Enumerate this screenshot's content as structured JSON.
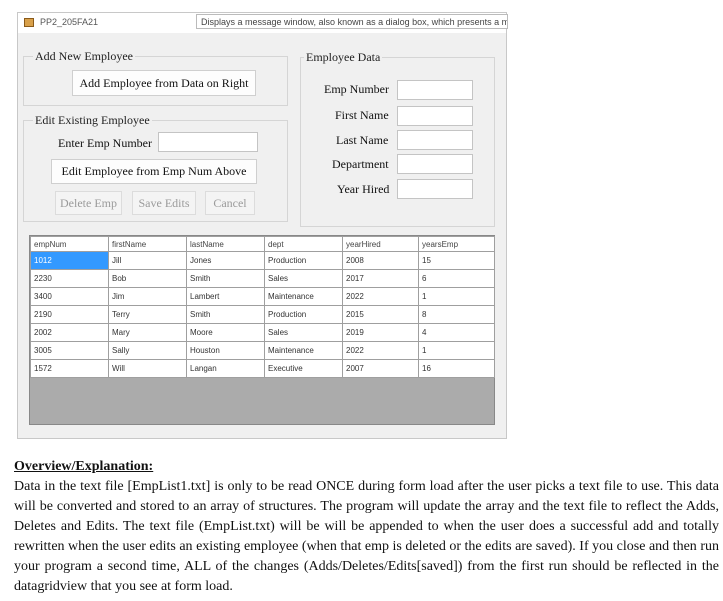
{
  "window": {
    "title": "PP2_205FA21",
    "tooltip": "Displays a message window, also known as a dialog box, which presents a m"
  },
  "add_group": {
    "title": "Add New Employee",
    "add_button": "Add Employee from Data on Right"
  },
  "edit_group": {
    "title": "Edit Existing Employee",
    "enter_label": "Enter Emp Number",
    "enter_value": "",
    "edit_button": "Edit Employee from Emp Num Above",
    "delete_button": "Delete Emp",
    "save_button": "Save Edits",
    "cancel_button": "Cancel"
  },
  "emp_group": {
    "title": "Employee Data",
    "emp_number_label": "Emp Number",
    "first_name_label": "First Name",
    "last_name_label": "Last Name",
    "department_label": "Department",
    "year_hired_label": "Year Hired"
  },
  "grid": {
    "columns": [
      "empNum",
      "firstName",
      "lastName",
      "dept",
      "yearHired",
      "yearsEmp"
    ],
    "rows": [
      [
        "1012",
        "Jill",
        "Jones",
        "Production",
        "2008",
        "15"
      ],
      [
        "2230",
        "Bob",
        "Smith",
        "Sales",
        "2017",
        "6"
      ],
      [
        "3400",
        "Jim",
        "Lambert",
        "Maintenance",
        "2022",
        "1"
      ],
      [
        "2190",
        "Terry",
        "Smith",
        "Production",
        "2015",
        "8"
      ],
      [
        "2002",
        "Mary",
        "Moore",
        "Sales",
        "2019",
        "4"
      ],
      [
        "3005",
        "Sally",
        "Houston",
        "Maintenance",
        "2022",
        "1"
      ],
      [
        "1572",
        "Will",
        "Langan",
        "Executive",
        "2007",
        "16"
      ]
    ]
  },
  "overview": {
    "title": "Overview/Explanation:",
    "body": "Data in the text file [EmpList1.txt] is only to be read ONCE during form load after the user picks a text file to use. This data will be converted and stored to an array of structures.  The program will update the array and the text file to reflect the Adds, Deletes and Edits.  The text file (EmpList.txt) will be will be appended to when the user does a successful add and totally rewritten when the user edits an existing employee (when that emp is deleted or the edits are saved).  If you close and then run your program a second time, ALL of the changes (Adds/Deletes/Edits[saved]) from the first run should be reflected in the datagridview that you see at form load."
  }
}
